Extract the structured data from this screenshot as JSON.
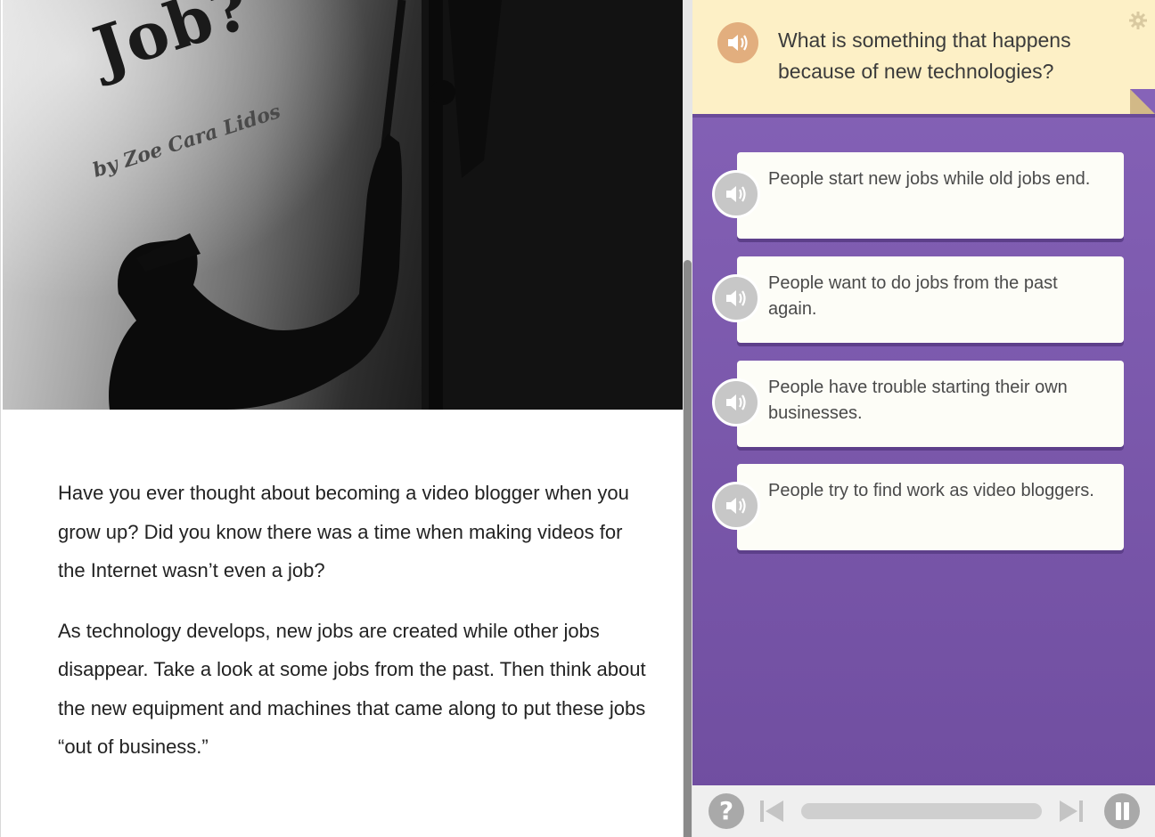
{
  "article": {
    "cover_title_visible": "Job?",
    "byline": "by Zoe Cara Lidos",
    "paragraphs": [
      "Have you ever thought about becoming a video blogger when you grow up? Did you know there was a time when making videos for the Internet wasn’t even a job?",
      "As technology develops, new jobs are created while other jobs disappear. Take a look at some jobs from the past. Then think about the new equipment and machines that came along to put these jobs “out of business.”"
    ]
  },
  "quiz": {
    "question": "What is something that happens because of new technologies?",
    "question_audio_icon": "speaker-icon",
    "settings_icon": "gear-icon",
    "answers": [
      {
        "text": "People start new jobs while old jobs end."
      },
      {
        "text": "People want to do jobs from the past again."
      },
      {
        "text": "People have trouble starting their own businesses."
      },
      {
        "text": "People try to find work as video bloggers."
      }
    ]
  },
  "controls": {
    "help_label": "?",
    "progress": 0,
    "icons": [
      "help-icon",
      "previous-icon",
      "next-icon",
      "pause-icon"
    ]
  },
  "colors": {
    "quiz_purple": "#7a57ad",
    "question_bg": "#fdf0c6",
    "question_audio": "#e2ae7e",
    "answer_bg": "#fdfdf7",
    "answer_audio": "#c7c7c7"
  }
}
